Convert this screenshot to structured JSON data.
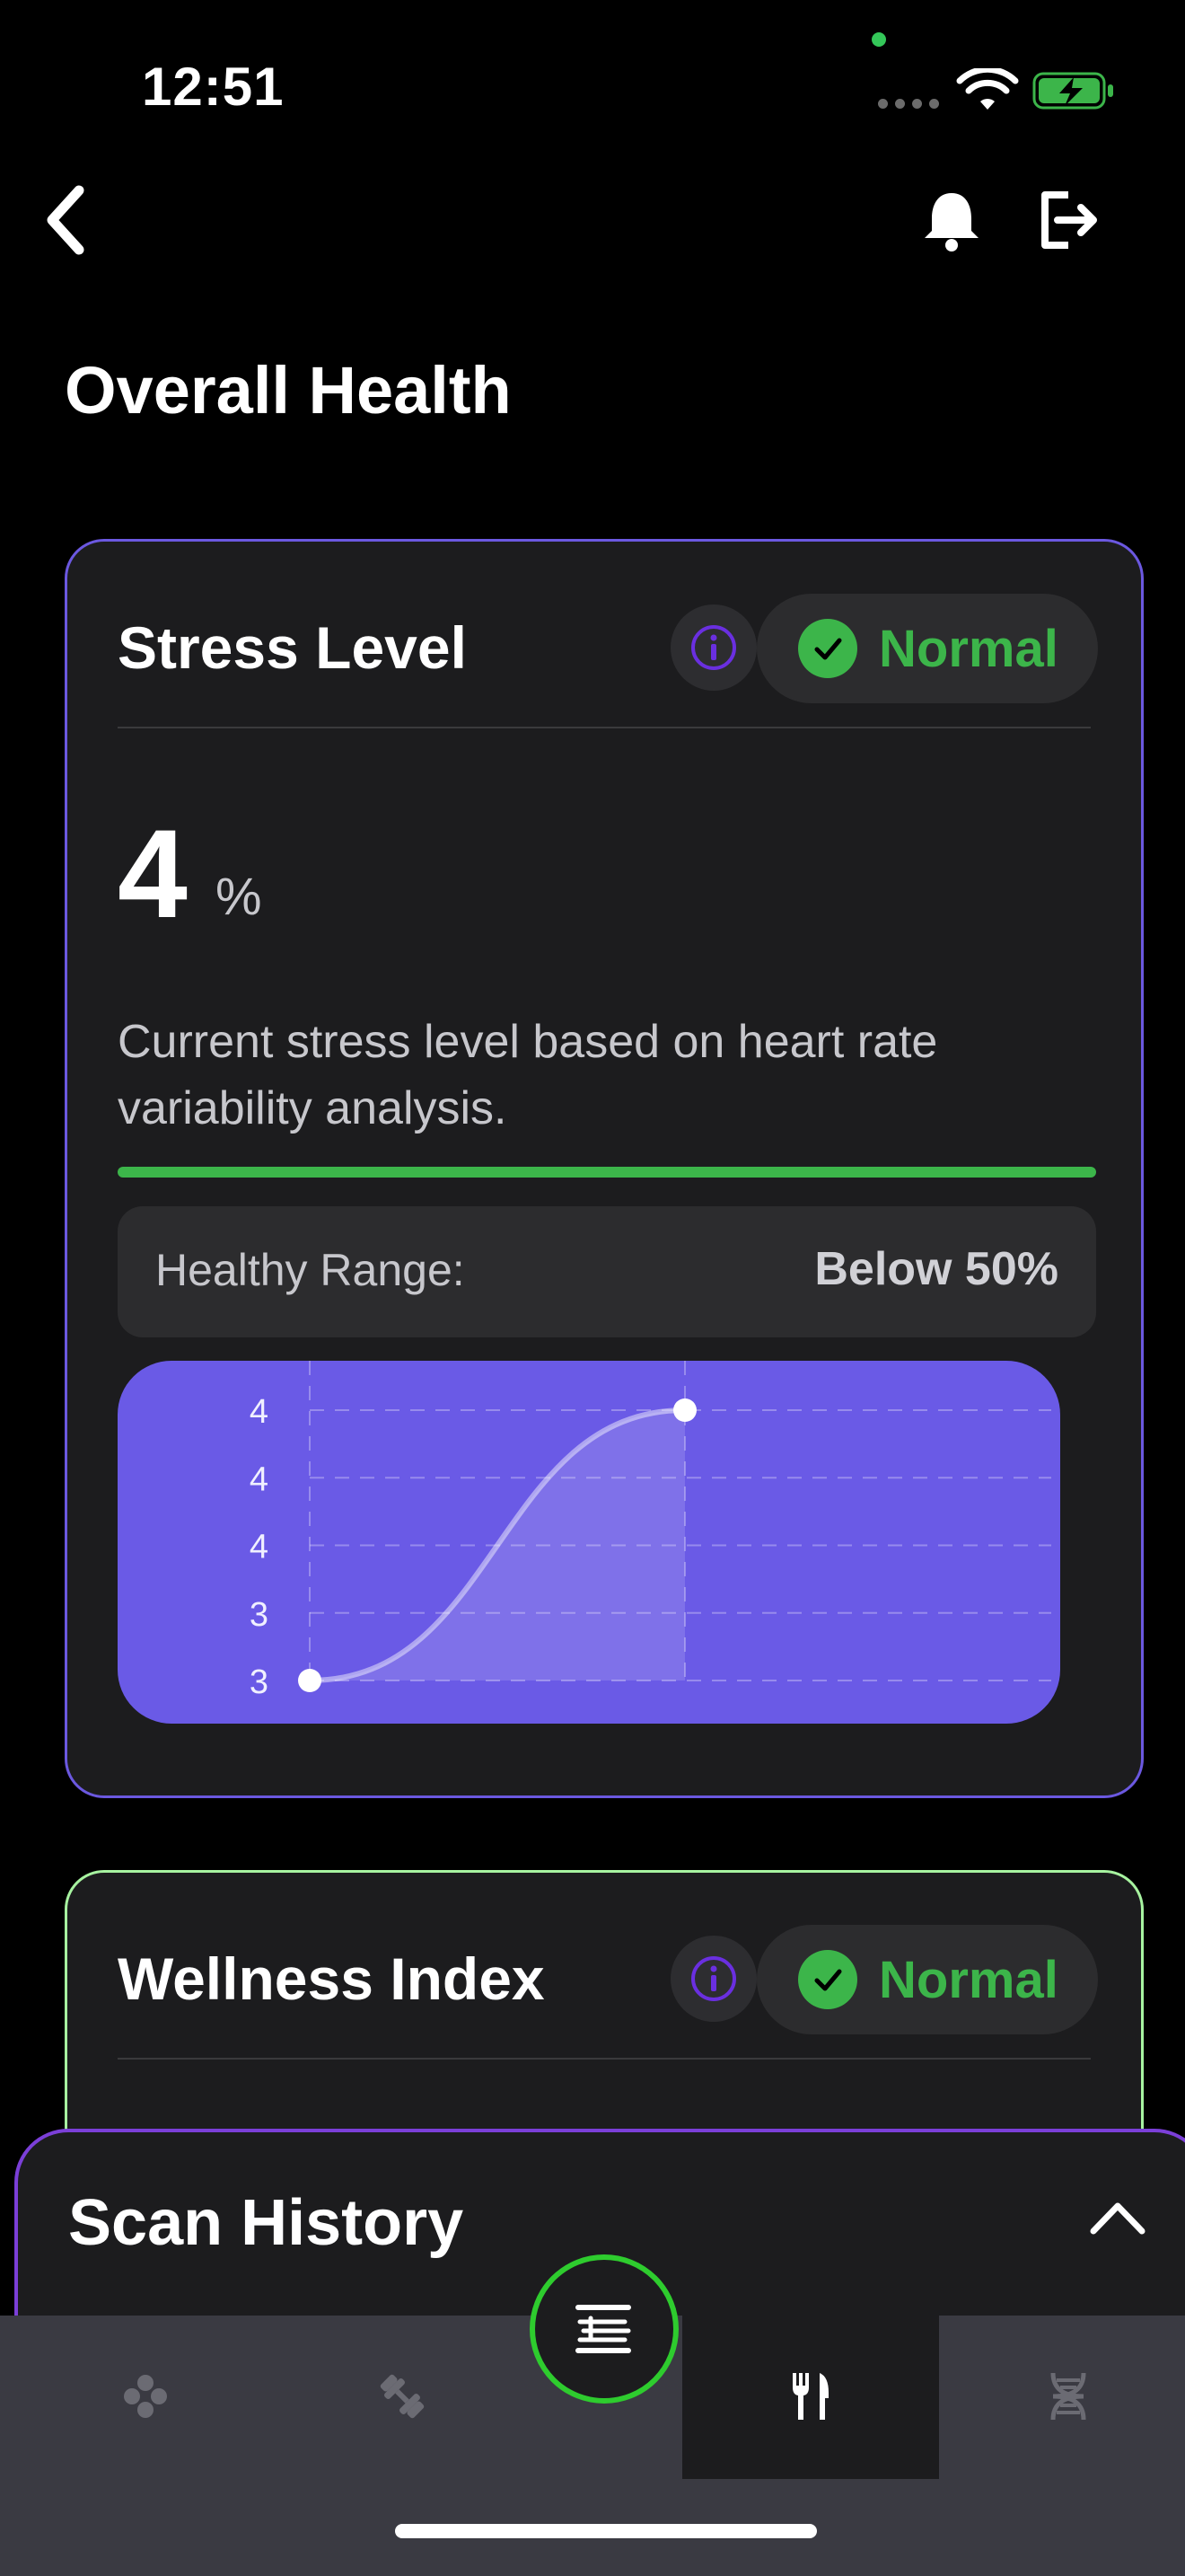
{
  "status_bar": {
    "time": "12:51",
    "wifi_icon": "wifi-icon",
    "battery_icon": "battery-charging-icon"
  },
  "nav": {
    "back_icon": "chevron-left-icon",
    "notifications_icon": "bell-icon",
    "logout_icon": "logout-icon"
  },
  "page": {
    "title": "Overall Health"
  },
  "stress_card": {
    "title": "Stress Level",
    "status": "Normal",
    "value": "4",
    "unit": "%",
    "description": "Current stress level based on heart rate variability analysis.",
    "range_label": "Healthy Range:",
    "range_value": "Below 50%",
    "colors": {
      "border": "#6b58e0",
      "status": "#3cb54a",
      "chart_bg": "#6a5ae6"
    }
  },
  "wellness_card": {
    "title": "Wellness Index",
    "status": "Normal",
    "colors": {
      "border": "#a7f3a0",
      "status": "#3cb54a"
    }
  },
  "scan_history": {
    "title": "Scan History"
  },
  "tabbar": {
    "items": [
      {
        "icon": "dots-cluster-icon"
      },
      {
        "icon": "dumbbell-icon"
      },
      {
        "icon": "fork-knife-icon",
        "active": true
      },
      {
        "icon": "dna-icon"
      }
    ],
    "fab_icon": "scan-lines-icon",
    "colors": {
      "fab_border": "#2ecc2e"
    }
  },
  "chart_data": {
    "type": "line",
    "title": "",
    "xlabel": "",
    "ylabel": "",
    "y_tick_labels": [
      "4",
      "4",
      "4",
      "3",
      "3"
    ],
    "ylim": [
      3.4,
      4.2
    ],
    "x": [
      0,
      1
    ],
    "series": [
      {
        "values": [
          3.4,
          4.2
        ]
      }
    ],
    "grid": true
  }
}
